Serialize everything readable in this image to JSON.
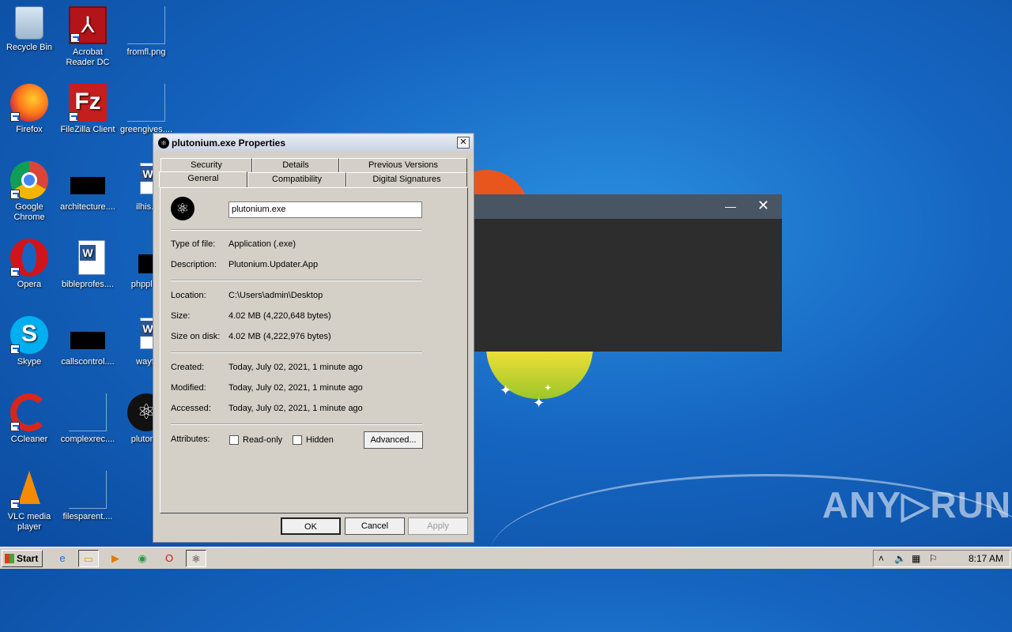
{
  "desktop": {
    "icons": [
      {
        "label": "Recycle Bin"
      },
      {
        "label": "Acrobat Reader DC"
      },
      {
        "label": "fromfl.png"
      },
      {
        "label": "Firefox"
      },
      {
        "label": "FileZilla Client"
      },
      {
        "label": "greengives...."
      },
      {
        "label": "Google Chrome"
      },
      {
        "label": "architecture...."
      },
      {
        "label": "ilhis.r"
      },
      {
        "label": "Opera"
      },
      {
        "label": "bibleprofes...."
      },
      {
        "label": "phpplay"
      },
      {
        "label": "Skype"
      },
      {
        "label": "callscontrol...."
      },
      {
        "label": "wayft"
      },
      {
        "label": "CCleaner"
      },
      {
        "label": "complexrec...."
      },
      {
        "label": "plutoniu"
      },
      {
        "label": "VLC media player"
      },
      {
        "label": "filesparent...."
      }
    ]
  },
  "dialog": {
    "title": "plutonium.exe Properties",
    "close": "✕",
    "tabs_row1": [
      "Security",
      "Details",
      "Previous Versions"
    ],
    "tabs_row2": [
      "General",
      "Compatibility",
      "Digital Signatures"
    ],
    "filename": "plutonium.exe",
    "fields": {
      "type_label": "Type of file:",
      "type_value": "Application (.exe)",
      "desc_label": "Description:",
      "desc_value": "Plutonium.Updater.App",
      "location_label": "Location:",
      "location_value": "C:\\Users\\admin\\Desktop",
      "size_label": "Size:",
      "size_value": "4.02 MB (4,220,648 bytes)",
      "sizeondisk_label": "Size on disk:",
      "sizeondisk_value": "4.02 MB (4,222,976 bytes)",
      "created_label": "Created:",
      "created_value": "Today, July 02, 2021, 1 minute ago",
      "modified_label": "Modified:",
      "modified_value": "Today, July 02, 2021, 1 minute ago",
      "accessed_label": "Accessed:",
      "accessed_value": "Today, July 02, 2021, 1 minute ago",
      "attributes_label": "Attributes:",
      "readonly_label": "Read-only",
      "hidden_label": "Hidden"
    },
    "advanced_label": "Advanced...",
    "ok_label": "OK",
    "cancel_label": "Cancel",
    "apply_label": "Apply"
  },
  "dark_window": {
    "minimize": "—",
    "close": "✕"
  },
  "taskbar": {
    "start_label": "Start",
    "clock": "8:17 AM"
  },
  "watermark": "ANY▷RUN"
}
